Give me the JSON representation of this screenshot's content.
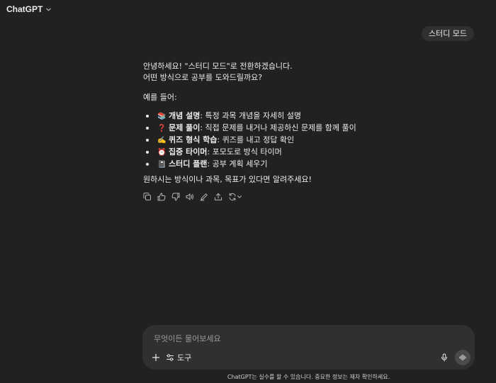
{
  "header": {
    "title": "ChatGPT"
  },
  "user_message": "스터디 모드",
  "assistant": {
    "intro_line1": "안녕하세요! \"스터디 모드\"로 전환하겠습니다.",
    "intro_line2": "어떤 방식으로 공부를 도와드릴까요?",
    "example_label": "예를 들어:",
    "items": [
      {
        "emoji": "📚",
        "title": "개념 설명",
        "desc": ": 특정 과목 개념을 자세히 설명"
      },
      {
        "emoji": "❓",
        "title": "문제 풀이",
        "desc": ": 직접 문제를 내거나 제공하신 문제를 함께 풀이"
      },
      {
        "emoji": "✍️",
        "title": "퀴즈 형식 학습",
        "desc": ": 퀴즈를 내고 정답 확인"
      },
      {
        "emoji": "⏰",
        "title": "집중 타이머",
        "desc": ": 포모도로 방식 타이머"
      },
      {
        "emoji": "📓",
        "title": "스터디 플랜",
        "desc": ": 공부 계획 세우기"
      }
    ],
    "outro": "원하시는 방식이나 과목, 목표가 있다면 알려주세요!"
  },
  "action_icons": [
    "copy-icon",
    "thumbs-up-icon",
    "thumbs-down-icon",
    "speaker-icon",
    "edit-icon",
    "share-icon",
    "regenerate-icon"
  ],
  "composer": {
    "placeholder": "무엇이든 물어보세요",
    "tools_label": "도구"
  },
  "disclaimer": "ChatGPT는 실수를 할 수 있습니다. 중요한 정보는 재차 확인하세요."
}
